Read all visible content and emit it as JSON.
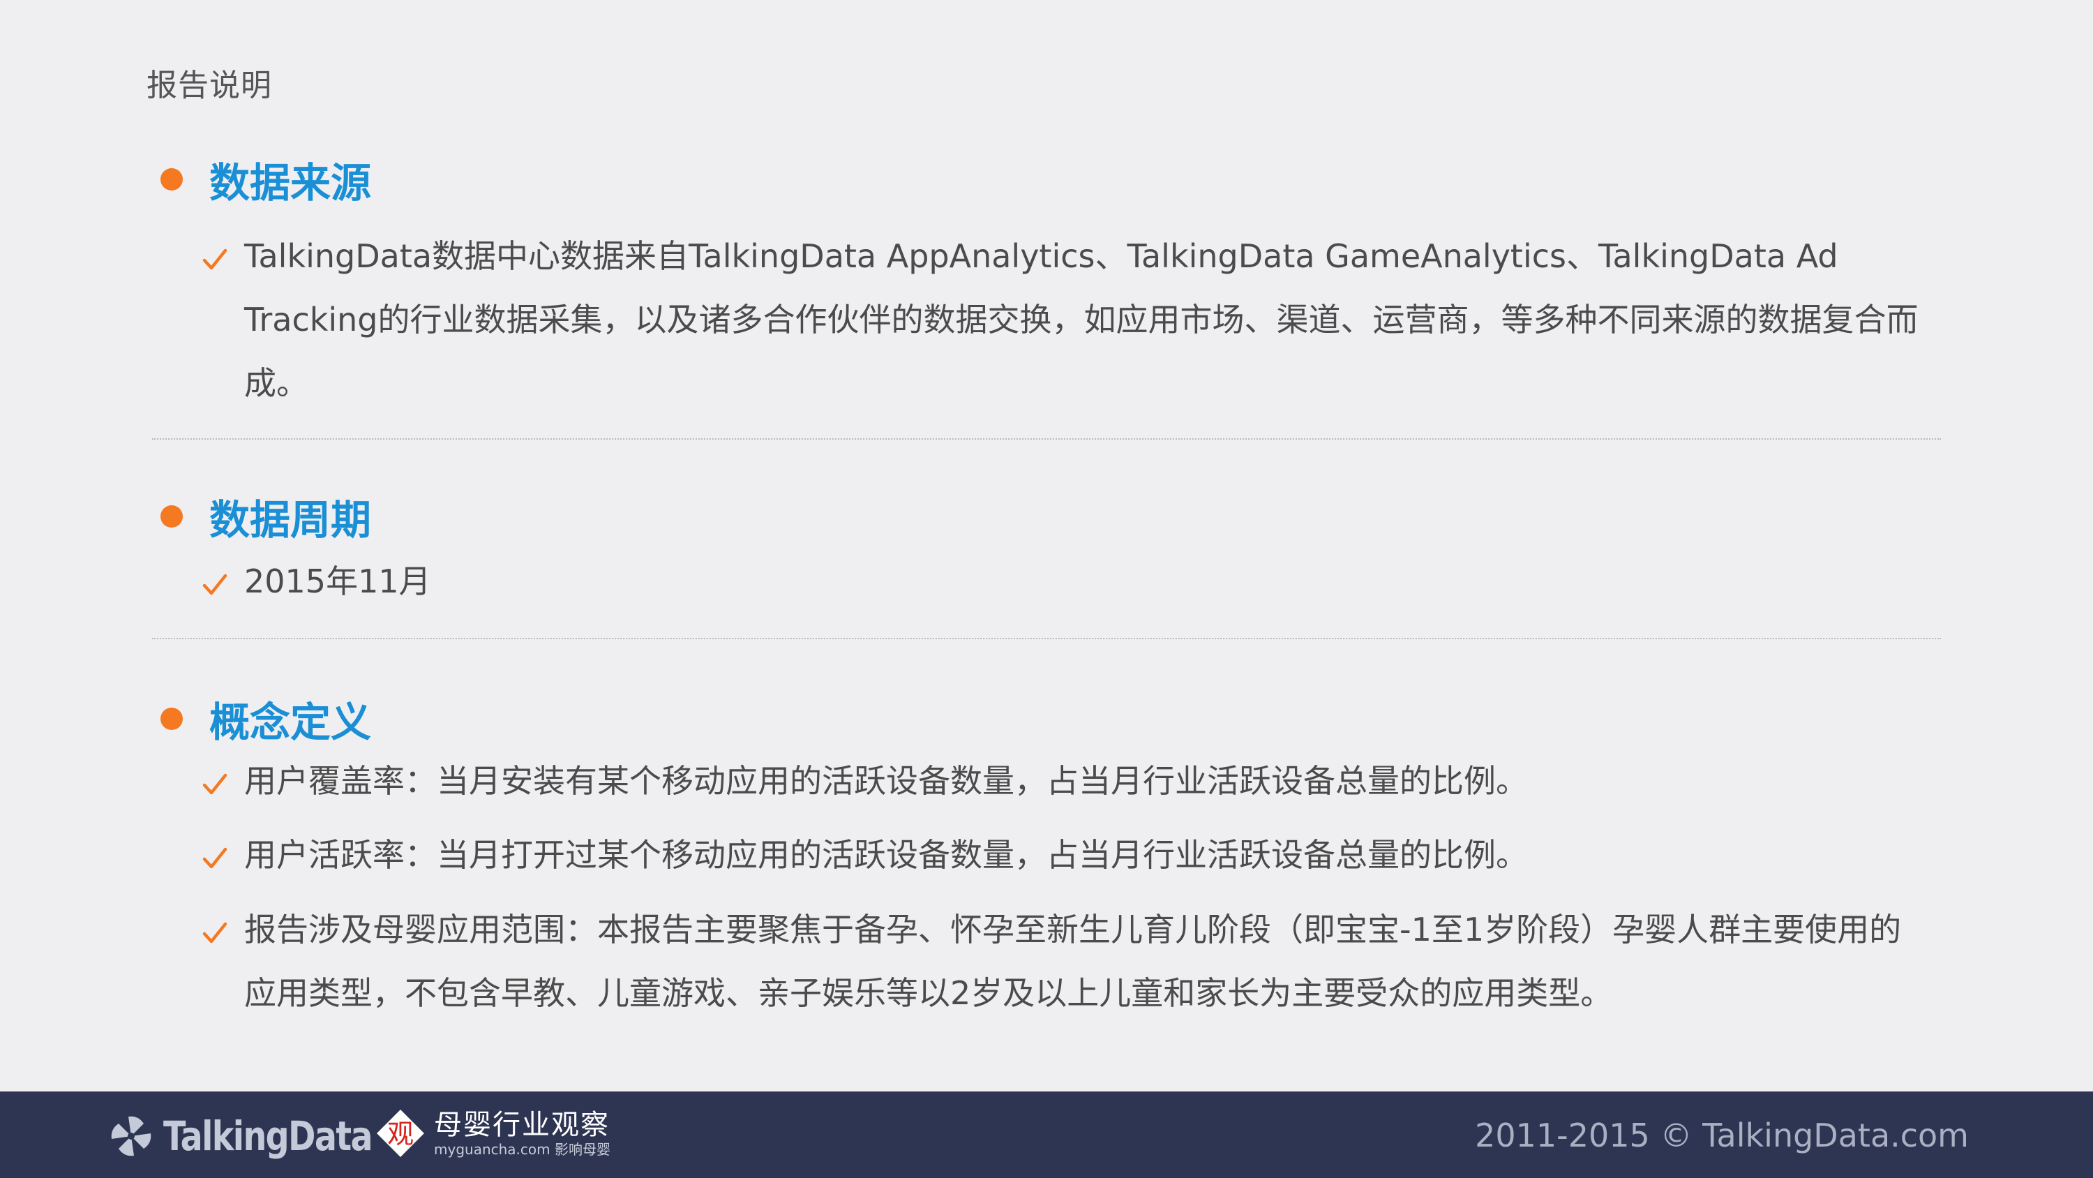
{
  "page_label": "报告说明",
  "sections": [
    {
      "title": "数据来源",
      "items": [
        "TalkingData数据中心数据来自TalkingData AppAnalytics、TalkingData GameAnalytics、TalkingData Ad Tracking的行业数据采集，以及诸多合作伙伴的数据交换，如应用市场、渠道、运营商，等多种不同来源的数据复合而成。"
      ]
    },
    {
      "title": "数据周期",
      "items": [
        "2015年11月"
      ]
    },
    {
      "title": "概念定义",
      "items": [
        "用户覆盖率：当月安装有某个移动应用的活跃设备数量，占当月行业活跃设备总量的比例。",
        "用户活跃率：当月打开过某个移动应用的活跃设备数量，占当月行业活跃设备总量的比例。",
        "报告涉及母婴应用范围：本报告主要聚焦于备孕、怀孕至新生儿育儿阶段（即宝宝-1至1岁阶段）孕婴人群主要使用的应用类型，不包含早教、儿童游戏、亲子娱乐等以2岁及以上儿童和家长为主要受众的应用类型。"
      ]
    }
  ],
  "footer": {
    "brand": "TalkingData",
    "partner_mark": "观",
    "partner_title": "母婴行业观察",
    "partner_sub": "myguancha.com 影响母婴",
    "copyright": "2011-2015 © TalkingData.com"
  },
  "colors": {
    "accent_orange": "#f47920",
    "title_blue": "#1a8fd5",
    "footer_bg": "#2d3552",
    "background": "#efeff2"
  }
}
